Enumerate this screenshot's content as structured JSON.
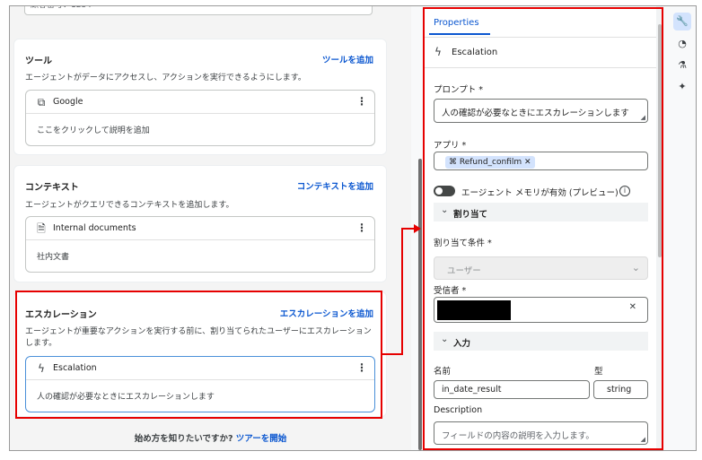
{
  "top_input": {
    "value": "顧客番号：1234"
  },
  "tools_card": {
    "title": "ツール",
    "add_label": "ツールを追加",
    "description": "エージェントがデータにアクセスし、アクションを実行できるようにします。",
    "item": {
      "name": "Google",
      "icon": "tool-icon",
      "description": "ここをクリックして説明を追加"
    }
  },
  "context_card": {
    "title": "コンテキスト",
    "add_label": "コンテキストを追加",
    "description": "エージェントがクエリできるコンテキストを追加します。",
    "item": {
      "name": "Internal documents",
      "icon": "document-icon",
      "description": "社内文書"
    }
  },
  "escalation_card": {
    "title": "エスカレーション",
    "add_label": "エスカレーションを追加",
    "description": "エージェントが重要なアクションを実行する前に、割り当てられたユーザーにエスカレーションします。",
    "item": {
      "name": "Escalation",
      "icon": "escalation-icon",
      "description": "人の確認が必要なときにエスカレーションします"
    }
  },
  "footer": {
    "prompt": "始め方を知りたいですか?",
    "tour_link": "ツアーを開始"
  },
  "properties": {
    "tab": "Properties",
    "title": "Escalation",
    "prompt_label": "プロンプト *",
    "prompt_value": "人の確認が必要なときにエスカレーションします",
    "app_label": "アプリ *",
    "app_chip": "Refund_confilm",
    "memory_toggle_label": "エージェント メモリが有効 (プレビュー)",
    "memory_toggle_on": false,
    "assign_section": "割り当て",
    "assign_condition_label": "割り当て条件 *",
    "assign_condition_value": "ユーザー",
    "recipient_label": "受信者 *",
    "input_section": "入力",
    "name_label": "名前",
    "type_label": "型",
    "name_value": "in_date_result",
    "type_value": "string",
    "description_label": "Description",
    "description_placeholder": "フィールドの内容の説明を入力します。"
  },
  "rail": [
    "wrench-icon",
    "gauge-icon",
    "flask-icon",
    "sparkle-icon"
  ],
  "colors": {
    "accent": "#0b57d0",
    "highlight": "#e60000",
    "chip": "#d3e3fd"
  }
}
